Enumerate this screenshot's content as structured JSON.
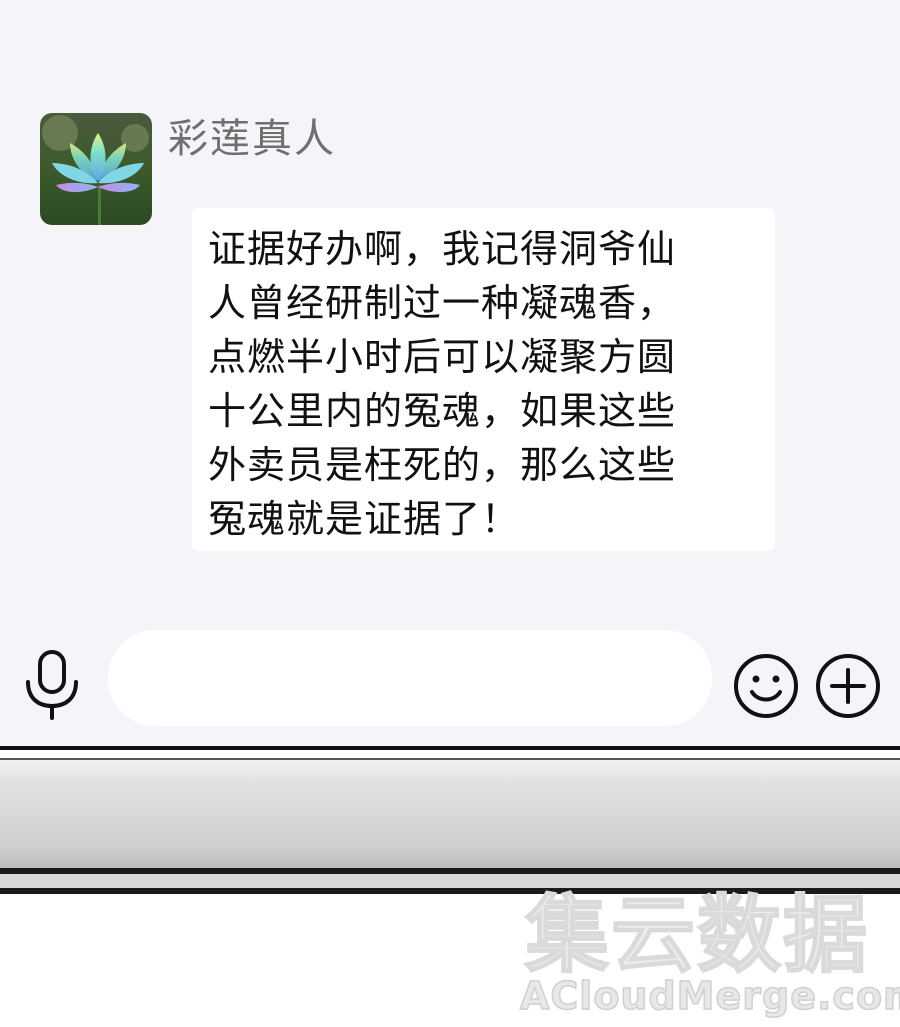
{
  "chat": {
    "sender_name": "彩莲真人",
    "avatar_icon": "lotus-icon",
    "message_lines": [
      "证据好办啊，我记得洞爷仙",
      "人曾经研制过一种凝魂香，",
      "点燃半小时后可以凝聚方圆",
      "十公里内的冤魂，如果这些",
      "外卖员是枉死的，那么这些",
      "冤魂就是证据了！"
    ]
  },
  "input_bar": {
    "voice_icon": "microphone-icon",
    "input_value": "",
    "emoji_icon": "smiley-icon",
    "more_icon": "plus-circle-icon"
  },
  "watermark": {
    "chinese": "集云数据",
    "english": "ACloudMerge.com"
  },
  "colors": {
    "screen_bg": "#f5f4f9",
    "bubble_bg": "#ffffff",
    "name_text": "#6f6f6f",
    "message_text": "#111111"
  }
}
